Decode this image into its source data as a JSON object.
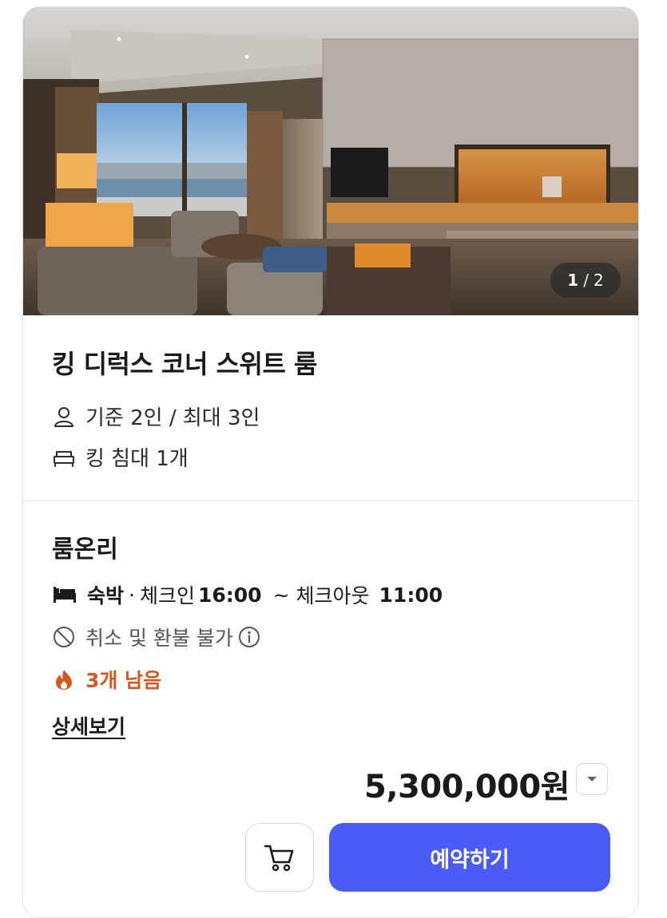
{
  "gallery": {
    "current": "1",
    "separator": "/",
    "total": "2"
  },
  "room": {
    "title": "킹 디럭스 코너 스위트 룸",
    "occupancy": "기준 2인 / 최대 3인",
    "bed": "킹 침대 1개"
  },
  "plan": {
    "title": "룸온리",
    "stay_type": "숙박",
    "dot": "·",
    "checkin_label": "체크인",
    "checkin_time": "16:00",
    "tilde": "~",
    "checkout_label": "체크아웃",
    "checkout_time": "11:00",
    "cancellation": "취소 및 환불 불가",
    "remaining": "3개 남음",
    "details_link": "상세보기"
  },
  "price": {
    "amount": "5,300,000원"
  },
  "actions": {
    "reserve_label": "예약하기"
  },
  "colors": {
    "primary": "#4a5bf7",
    "remaining": "#d4581d"
  },
  "icons": {
    "occupancy": "person-icon",
    "bed": "bed-outline-icon",
    "stay": "bed-filled-icon",
    "cancel": "no-entry-icon",
    "info": "info-icon",
    "remaining": "flame-icon",
    "price_toggle": "caret-down-icon",
    "cart": "cart-icon"
  }
}
